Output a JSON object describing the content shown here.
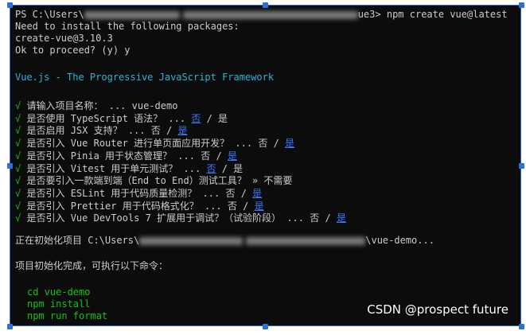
{
  "terminal": {
    "prompt": "PS C:\\Users\\",
    "prompt_tail": "ue3>",
    "command": "npm create vue@latest",
    "need_install": "Need to install the following packages:",
    "package": "create-vue@3.10.3",
    "ok_proceed": "Ok to proceed? (y) y",
    "banner": "Vue.js - The Progressive JavaScript Framework",
    "tick_symbol": "√",
    "questions": [
      {
        "label": "请输入项目名称：",
        "dots": "...",
        "answer": "vue-demo"
      },
      {
        "label": "是否使用 TypeScript 语法？",
        "dots": "...",
        "no": "否",
        "sep": "/",
        "yes": "是",
        "selected": "no"
      },
      {
        "label": "是否启用 JSX 支持？",
        "dots": "...",
        "no": "否",
        "sep": "/",
        "yes": "是",
        "selected": "yes"
      },
      {
        "label": "是否引入 Vue Router 进行单页面应用开发？",
        "dots": "...",
        "no": "否",
        "sep": "/",
        "yes": "是",
        "selected": "yes"
      },
      {
        "label": "是否引入 Pinia 用于状态管理？",
        "dots": "...",
        "no": "否",
        "sep": "/",
        "yes": "是",
        "selected": "yes"
      },
      {
        "label": "是否引入 Vitest 用于单元测试？",
        "dots": "...",
        "no": "否",
        "sep": "/",
        "yes": "是",
        "selected": "no"
      },
      {
        "label": "是否要引入一款端到端（End to End）测试工具？",
        "dots": "»",
        "answer": "不需要"
      },
      {
        "label": "是否引入 ESLint 用于代码质量检测？",
        "dots": "...",
        "no": "否",
        "sep": "/",
        "yes": "是",
        "selected": "yes"
      },
      {
        "label": "是否引入 Prettier 用于代码格式化？",
        "dots": "...",
        "no": "否",
        "sep": "/",
        "yes": "是",
        "selected": "yes"
      },
      {
        "label": "是否引入 Vue DevTools 7 扩展用于调试？（试验阶段）",
        "dots": "...",
        "no": "否",
        "sep": "/",
        "yes": "是",
        "selected": "yes"
      }
    ],
    "init_prefix": "正在初始化项目 C:\\Users\\",
    "init_suffix": "\\vue-demo...",
    "done": "项目初始化完成，可执行以下命令：",
    "commands": [
      "cd vue-demo",
      "npm install",
      "npm run format"
    ]
  },
  "watermark": "CSDN @prospect future",
  "colors": {
    "background": "#0c0c0c",
    "text": "#cccccc",
    "green": "#13c313",
    "cyan": "#2bb3d6",
    "blue": "#3b78ff",
    "selection": "#2f6fd6"
  }
}
